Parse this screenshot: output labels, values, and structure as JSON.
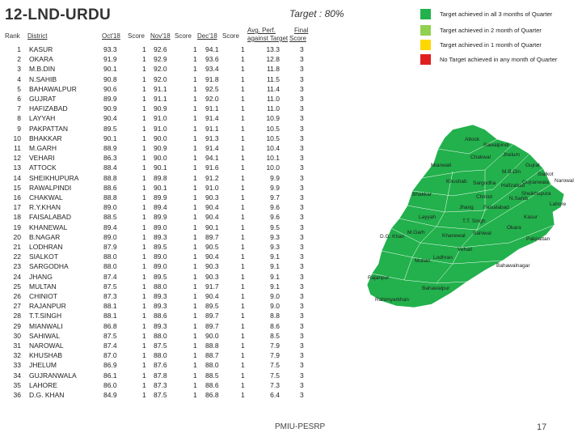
{
  "title": "12-LND-URDU",
  "target": "Target : 80%",
  "headers": {
    "rank": "Rank",
    "district": "District",
    "oct": "Oct'18",
    "score1": "Score",
    "nov": "Nov'18",
    "score2": "Score",
    "dec": "Dec'18",
    "score3": "Score",
    "avg1": "Avg. Perf.",
    "avg2": "against Target",
    "final1": "Final",
    "final2": "Score"
  },
  "rows": [
    {
      "rank": "1",
      "district": "KASUR",
      "oct": "93.3",
      "s1": "1",
      "nov": "92.6",
      "s2": "1",
      "dec": "94.1",
      "s3": "1",
      "avg": "13.3",
      "final": "3"
    },
    {
      "rank": "2",
      "district": "OKARA",
      "oct": "91.9",
      "s1": "1",
      "nov": "92.9",
      "s2": "1",
      "dec": "93.6",
      "s3": "1",
      "avg": "12.8",
      "final": "3"
    },
    {
      "rank": "3",
      "district": "M.B.DIN",
      "oct": "90.1",
      "s1": "1",
      "nov": "92.0",
      "s2": "1",
      "dec": "93.4",
      "s3": "1",
      "avg": "11.8",
      "final": "3"
    },
    {
      "rank": "4",
      "district": "N.SAHIB",
      "oct": "90.8",
      "s1": "1",
      "nov": "92.0",
      "s2": "1",
      "dec": "91.8",
      "s3": "1",
      "avg": "11.5",
      "final": "3"
    },
    {
      "rank": "5",
      "district": "BAHAWALPUR",
      "oct": "90.6",
      "s1": "1",
      "nov": "91.1",
      "s2": "1",
      "dec": "92.5",
      "s3": "1",
      "avg": "11.4",
      "final": "3"
    },
    {
      "rank": "6",
      "district": "GUJRAT",
      "oct": "89.9",
      "s1": "1",
      "nov": "91.1",
      "s2": "1",
      "dec": "92.0",
      "s3": "1",
      "avg": "11.0",
      "final": "3"
    },
    {
      "rank": "7",
      "district": "HAFIZABAD",
      "oct": "90.9",
      "s1": "1",
      "nov": "90.9",
      "s2": "1",
      "dec": "91.1",
      "s3": "1",
      "avg": "11.0",
      "final": "3"
    },
    {
      "rank": "8",
      "district": "LAYYAH",
      "oct": "90.4",
      "s1": "1",
      "nov": "91.0",
      "s2": "1",
      "dec": "91.4",
      "s3": "1",
      "avg": "10.9",
      "final": "3"
    },
    {
      "rank": "9",
      "district": "PAKPATTAN",
      "oct": "89.5",
      "s1": "1",
      "nov": "91.0",
      "s2": "1",
      "dec": "91.1",
      "s3": "1",
      "avg": "10.5",
      "final": "3"
    },
    {
      "rank": "10",
      "district": "BHAKKAR",
      "oct": "90.1",
      "s1": "1",
      "nov": "90.0",
      "s2": "1",
      "dec": "91.3",
      "s3": "1",
      "avg": "10.5",
      "final": "3"
    },
    {
      "rank": "11",
      "district": "M.GARH",
      "oct": "88.9",
      "s1": "1",
      "nov": "90.9",
      "s2": "1",
      "dec": "91.4",
      "s3": "1",
      "avg": "10.4",
      "final": "3"
    },
    {
      "rank": "12",
      "district": "VEHARI",
      "oct": "86.3",
      "s1": "1",
      "nov": "90.0",
      "s2": "1",
      "dec": "94.1",
      "s3": "1",
      "avg": "10.1",
      "final": "3"
    },
    {
      "rank": "13",
      "district": "ATTOCK",
      "oct": "88.4",
      "s1": "1",
      "nov": "90.1",
      "s2": "1",
      "dec": "91.6",
      "s3": "1",
      "avg": "10.0",
      "final": "3"
    },
    {
      "rank": "14",
      "district": "SHEIKHUPURA",
      "oct": "88.8",
      "s1": "1",
      "nov": "89.8",
      "s2": "1",
      "dec": "91.2",
      "s3": "1",
      "avg": "9.9",
      "final": "3"
    },
    {
      "rank": "15",
      "district": "RAWALPINDI",
      "oct": "88.6",
      "s1": "1",
      "nov": "90.1",
      "s2": "1",
      "dec": "91.0",
      "s3": "1",
      "avg": "9.9",
      "final": "3"
    },
    {
      "rank": "16",
      "district": "CHAKWAL",
      "oct": "88.8",
      "s1": "1",
      "nov": "89.9",
      "s2": "1",
      "dec": "90.3",
      "s3": "1",
      "avg": "9.7",
      "final": "3"
    },
    {
      "rank": "17",
      "district": "R.Y.KHAN",
      "oct": "89.0",
      "s1": "1",
      "nov": "89.4",
      "s2": "1",
      "dec": "90.4",
      "s3": "1",
      "avg": "9.6",
      "final": "3"
    },
    {
      "rank": "18",
      "district": "FAISALABAD",
      "oct": "88.5",
      "s1": "1",
      "nov": "89.9",
      "s2": "1",
      "dec": "90.4",
      "s3": "1",
      "avg": "9.6",
      "final": "3"
    },
    {
      "rank": "19",
      "district": "KHANEWAL",
      "oct": "89.4",
      "s1": "1",
      "nov": "89.0",
      "s2": "1",
      "dec": "90.1",
      "s3": "1",
      "avg": "9.5",
      "final": "3"
    },
    {
      "rank": "20",
      "district": "B.NAGAR",
      "oct": "89.0",
      "s1": "1",
      "nov": "89.3",
      "s2": "1",
      "dec": "89.7",
      "s3": "1",
      "avg": "9.3",
      "final": "3"
    },
    {
      "rank": "21",
      "district": "LODHRAN",
      "oct": "87.9",
      "s1": "1",
      "nov": "89.5",
      "s2": "1",
      "dec": "90.5",
      "s3": "1",
      "avg": "9.3",
      "final": "3"
    },
    {
      "rank": "22",
      "district": "SIALKOT",
      "oct": "88.0",
      "s1": "1",
      "nov": "89.0",
      "s2": "1",
      "dec": "90.4",
      "s3": "1",
      "avg": "9.1",
      "final": "3"
    },
    {
      "rank": "23",
      "district": "SARGODHA",
      "oct": "88.0",
      "s1": "1",
      "nov": "89.0",
      "s2": "1",
      "dec": "90.3",
      "s3": "1",
      "avg": "9.1",
      "final": "3"
    },
    {
      "rank": "24",
      "district": "JHANG",
      "oct": "87.4",
      "s1": "1",
      "nov": "89.5",
      "s2": "1",
      "dec": "90.3",
      "s3": "1",
      "avg": "9.1",
      "final": "3"
    },
    {
      "rank": "25",
      "district": "MULTAN",
      "oct": "87.5",
      "s1": "1",
      "nov": "88.0",
      "s2": "1",
      "dec": "91.7",
      "s3": "1",
      "avg": "9.1",
      "final": "3"
    },
    {
      "rank": "26",
      "district": "CHINIOT",
      "oct": "87.3",
      "s1": "1",
      "nov": "89.3",
      "s2": "1",
      "dec": "90.4",
      "s3": "1",
      "avg": "9.0",
      "final": "3"
    },
    {
      "rank": "27",
      "district": "RAJANPUR",
      "oct": "88.1",
      "s1": "1",
      "nov": "89.3",
      "s2": "1",
      "dec": "89.5",
      "s3": "1",
      "avg": "9.0",
      "final": "3"
    },
    {
      "rank": "28",
      "district": "T.T.SINGH",
      "oct": "88.1",
      "s1": "1",
      "nov": "88.6",
      "s2": "1",
      "dec": "89.7",
      "s3": "1",
      "avg": "8.8",
      "final": "3"
    },
    {
      "rank": "29",
      "district": "MIANWALI",
      "oct": "86.8",
      "s1": "1",
      "nov": "89.3",
      "s2": "1",
      "dec": "89.7",
      "s3": "1",
      "avg": "8.6",
      "final": "3"
    },
    {
      "rank": "30",
      "district": "SAHIWAL",
      "oct": "87.5",
      "s1": "1",
      "nov": "88.0",
      "s2": "1",
      "dec": "90.0",
      "s3": "1",
      "avg": "8.5",
      "final": "3"
    },
    {
      "rank": "31",
      "district": "NAROWAL",
      "oct": "87.4",
      "s1": "1",
      "nov": "87.5",
      "s2": "1",
      "dec": "88.8",
      "s3": "1",
      "avg": "7.9",
      "final": "3"
    },
    {
      "rank": "32",
      "district": "KHUSHAB",
      "oct": "87.0",
      "s1": "1",
      "nov": "88.0",
      "s2": "1",
      "dec": "88.7",
      "s3": "1",
      "avg": "7.9",
      "final": "3"
    },
    {
      "rank": "33",
      "district": "JHELUM",
      "oct": "86.9",
      "s1": "1",
      "nov": "87.6",
      "s2": "1",
      "dec": "88.0",
      "s3": "1",
      "avg": "7.5",
      "final": "3"
    },
    {
      "rank": "34",
      "district": "GUJRANWALA",
      "oct": "86.1",
      "s1": "1",
      "nov": "87.8",
      "s2": "1",
      "dec": "88.5",
      "s3": "1",
      "avg": "7.5",
      "final": "3"
    },
    {
      "rank": "35",
      "district": "LAHORE",
      "oct": "86.0",
      "s1": "1",
      "nov": "87.3",
      "s2": "1",
      "dec": "88.6",
      "s3": "1",
      "avg": "7.3",
      "final": "3"
    },
    {
      "rank": "36",
      "district": "D.G. KHAN",
      "oct": "84.9",
      "s1": "1",
      "nov": "87.5",
      "s2": "1",
      "dec": "86.8",
      "s3": "1",
      "avg": "6.4",
      "final": "3"
    }
  ],
  "legend": [
    {
      "label": "Target achieved in all 3 months of Quarter",
      "color": "#22b14c"
    },
    {
      "label": "Target achieved in 2 month of Quarter",
      "color": "#92d050"
    },
    {
      "label": "Target achieved in 1 month of Quarter",
      "color": "#ffd700"
    },
    {
      "label": "No Target achieved in any month of Quarter",
      "color": "#e02020"
    }
  ],
  "map": {
    "fill": "#22b14c",
    "labels": [
      {
        "text": "Attock",
        "key": "attock"
      },
      {
        "text": "Rawalpindi",
        "key": "rawalpindi"
      },
      {
        "text": "Jhelum",
        "key": "jhelum"
      },
      {
        "text": "Chakwal",
        "key": "chakwal"
      },
      {
        "text": "Mianwali",
        "key": "mianwali"
      },
      {
        "text": "Gujrat",
        "key": "gujrat"
      },
      {
        "text": "M.B.Din",
        "key": "mbdin"
      },
      {
        "text": "Sialkot",
        "key": "sialkot"
      },
      {
        "text": "Narowal",
        "key": "narowal"
      },
      {
        "text": "Khushab",
        "key": "khushab"
      },
      {
        "text": "Sargodha",
        "key": "sargodha"
      },
      {
        "text": "Hafizabad",
        "key": "hafizabad"
      },
      {
        "text": "Gujranwala",
        "key": "gujranwala"
      },
      {
        "text": "Sheikhupura",
        "key": "sheikhupura"
      },
      {
        "text": "Bhakkar",
        "key": "bhakkar"
      },
      {
        "text": "Chiniot",
        "key": "chiniot"
      },
      {
        "text": "N.Sahib",
        "key": "nsahib"
      },
      {
        "text": "Lahore",
        "key": "lahore"
      },
      {
        "text": "Jhang",
        "key": "jhang"
      },
      {
        "text": "Faisalabad",
        "key": "faisalabad"
      },
      {
        "text": "Kasur",
        "key": "kasur"
      },
      {
        "text": "Layyah",
        "key": "layyah"
      },
      {
        "text": "T.T. Singh",
        "key": "tts"
      },
      {
        "text": "Okara",
        "key": "okara"
      },
      {
        "text": "D.G. Khan",
        "key": "dgkhan"
      },
      {
        "text": "M.Garh",
        "key": "mgarh"
      },
      {
        "text": "Khanewal",
        "key": "khanewal"
      },
      {
        "text": "Sahiwal",
        "key": "sahiwal"
      },
      {
        "text": "Pakpattan",
        "key": "pakpattan"
      },
      {
        "text": "Vehari",
        "key": "vehari"
      },
      {
        "text": "Lodhran",
        "key": "lodhran"
      },
      {
        "text": "Multan",
        "key": "multan"
      },
      {
        "text": "Bahawalnagar",
        "key": "bnagar"
      },
      {
        "text": "Rajanpur",
        "key": "rajanpur"
      },
      {
        "text": "Bahawalpur",
        "key": "bahawalpur"
      },
      {
        "text": "Rahimyarkhan",
        "key": "rykhan"
      }
    ]
  },
  "footer": "PMIU-PESRP",
  "page": "17"
}
